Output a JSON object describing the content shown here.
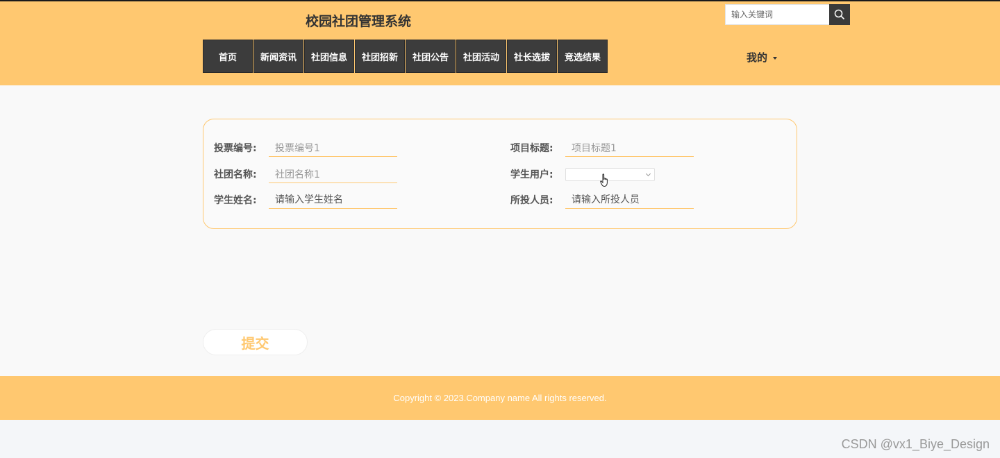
{
  "header": {
    "site_title": "校园社团管理系统",
    "search_placeholder": "输入关键词",
    "user_menu_label": "我的"
  },
  "nav": {
    "items": [
      "首页",
      "新闻资讯",
      "社团信息",
      "社团招新",
      "社团公告",
      "社团活动",
      "社长选拔",
      "竞选结果"
    ]
  },
  "form": {
    "vote_no": {
      "label": "投票编号:",
      "value": "投票编号1"
    },
    "project_title": {
      "label": "项目标题:",
      "value": "项目标题1"
    },
    "club_name": {
      "label": "社团名称:",
      "value": "社团名称1"
    },
    "student_user": {
      "label": "学生用户:",
      "value": ""
    },
    "student_name": {
      "label": "学生姓名:",
      "placeholder": "请输入学生姓名"
    },
    "voted_person": {
      "label": "所投人员:",
      "placeholder": "请输入所投人员"
    }
  },
  "submit_label": "提交",
  "footer": {
    "copyright": "Copyright © 2023.Company name All rights reserved."
  },
  "watermark": "CSDN @vx1_Biye_Design",
  "colors": {
    "accent": "#ffc870",
    "nav_bg": "#3c3c3c"
  }
}
